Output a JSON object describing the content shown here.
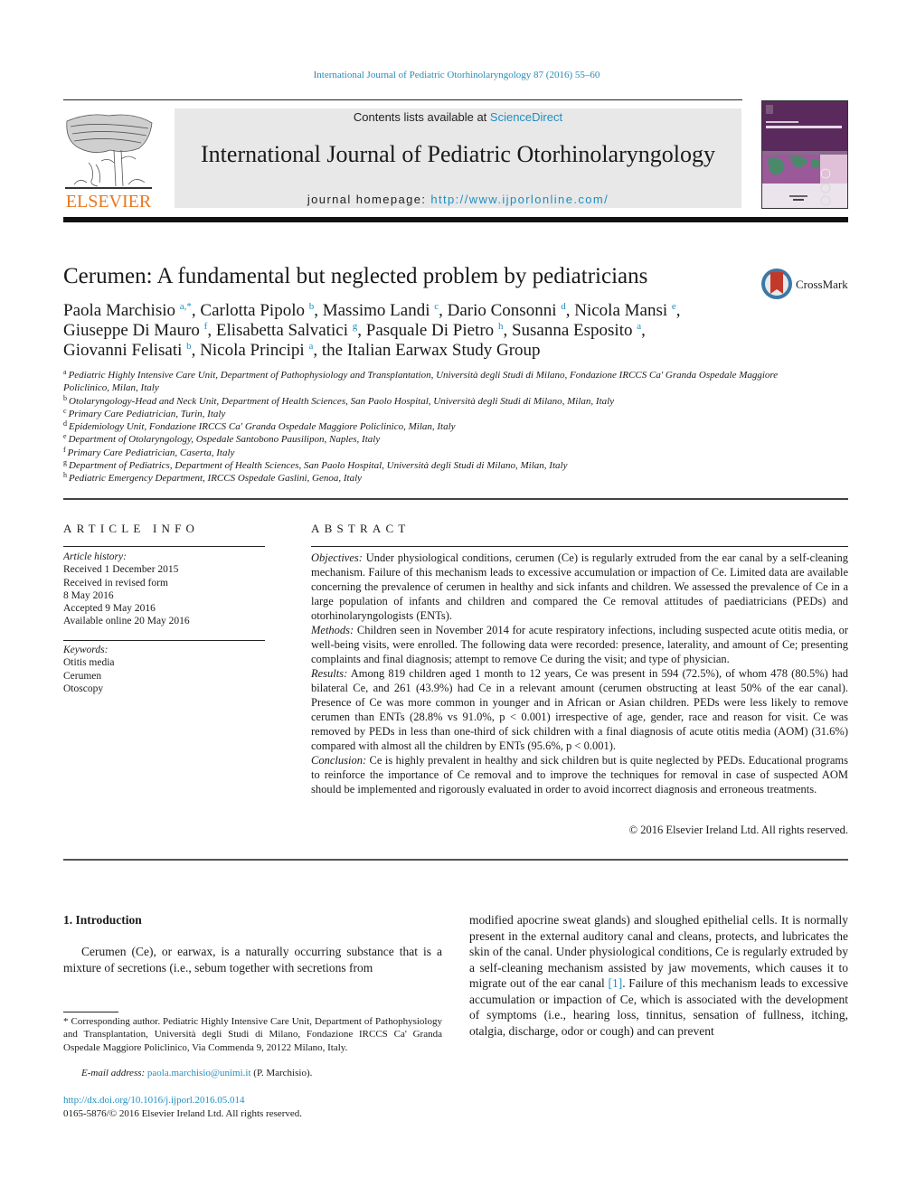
{
  "running_header": "International Journal of Pediatric Otorhinolaryngology 87 (2016) 55–60",
  "masthead": {
    "publisher_logo_text": "ELSEVIER",
    "contents_prefix": "Contents lists available at ",
    "contents_link": "ScienceDirect",
    "journal_title": "International Journal of Pediatric Otorhinolaryngology",
    "homepage_prefix": "journal homepage: ",
    "homepage_url": "http://www.ijporlonline.com/",
    "cover_title": "Pediatric Otorhinolaryngology"
  },
  "colors": {
    "link": "#1f8fc0",
    "elsevier_orange": "#e87722",
    "masthead_bg": "#e8e8e8",
    "cover_purple": "#5a2a5c"
  },
  "article": {
    "title": "Cerumen: A fundamental but neglected problem by pediatricians",
    "crossmark_label": "CrossMark",
    "authors": [
      {
        "name": "Paola Marchisio",
        "aff": "a,*",
        "sep": ", "
      },
      {
        "name": "Carlotta Pipolo",
        "aff": "b",
        "sep": ", "
      },
      {
        "name": "Massimo Landi",
        "aff": "c",
        "sep": ", "
      },
      {
        "name": "Dario Consonni",
        "aff": "d",
        "sep": ", "
      },
      {
        "name": "Nicola Mansi",
        "aff": "e",
        "sep": ","
      },
      {
        "name": "Giuseppe Di Mauro",
        "aff": "f",
        "sep": ", "
      },
      {
        "name": "Elisabetta Salvatici",
        "aff": "g",
        "sep": ", "
      },
      {
        "name": "Pasquale Di Pietro",
        "aff": "h",
        "sep": ", "
      },
      {
        "name": "Susanna Esposito",
        "aff": "a",
        "sep": ","
      },
      {
        "name": "Giovanni Felisati",
        "aff": "b",
        "sep": ", "
      },
      {
        "name": "Nicola Principi",
        "aff": "a",
        "sep": ", "
      },
      {
        "name": "the Italian Earwax Study Group",
        "aff": "",
        "sep": ""
      }
    ],
    "affiliations": [
      {
        "key": "a",
        "text": "Pediatric Highly Intensive Care Unit, Department of Pathophysiology and Transplantation, Università degli Studi di Milano, Fondazione IRCCS Ca' Granda Ospedale Maggiore Policlinico, Milan, Italy"
      },
      {
        "key": "b",
        "text": "Otolaryngology-Head and Neck Unit, Department of Health Sciences, San Paolo Hospital, Università degli Studi di Milano, Milan, Italy"
      },
      {
        "key": "c",
        "text": "Primary Care Pediatrician, Turin, Italy"
      },
      {
        "key": "d",
        "text": "Epidemiology Unit, Fondazione IRCCS Ca' Granda Ospedale Maggiore Policlinico, Milan, Italy"
      },
      {
        "key": "e",
        "text": "Department of Otolaryngology, Ospedale Santobono Pausilipon, Naples, Italy"
      },
      {
        "key": "f",
        "text": "Primary Care Pediatrician, Caserta, Italy"
      },
      {
        "key": "g",
        "text": "Department of Pediatrics, Department of Health Sciences, San Paolo Hospital, Università degli Studi di Milano, Milan, Italy"
      },
      {
        "key": "h",
        "text": "Pediatric Emergency Department, IRCCS Ospedale Gaslini, Genoa, Italy"
      }
    ]
  },
  "article_info": {
    "heading": "ARTICLE INFO",
    "history_label": "Article history:",
    "history": [
      "Received 1 December 2015",
      "Received in revised form",
      "8 May 2016",
      "Accepted 9 May 2016",
      "Available online 20 May 2016"
    ],
    "keywords_label": "Keywords:",
    "keywords": [
      "Otitis media",
      "Cerumen",
      "Otoscopy"
    ]
  },
  "abstract": {
    "heading": "ABSTRACT",
    "sections": [
      {
        "label": "Objectives:",
        "text": "Under physiological conditions, cerumen (Ce) is regularly extruded from the ear canal by a self-cleaning mechanism. Failure of this mechanism leads to excessive accumulation or impaction of Ce. Limited data are available concerning the prevalence of cerumen in healthy and sick infants and children. We assessed the prevalence of Ce in a large population of infants and children and compared the Ce removal attitudes of paediatricians (PEDs) and otorhinolaryngologists (ENTs)."
      },
      {
        "label": "Methods:",
        "text": "Children seen in November 2014 for acute respiratory infections, including suspected acute otitis media, or well-being visits, were enrolled. The following data were recorded: presence, laterality, and amount of Ce; presenting complaints and final diagnosis; attempt to remove Ce during the visit; and type of physician."
      },
      {
        "label": "Results:",
        "text": "Among 819 children aged 1 month to 12 years, Ce was present in 594 (72.5%), of whom 478 (80.5%) had bilateral Ce, and 261 (43.9%) had Ce in a relevant amount (cerumen obstructing at least 50% of the ear canal). Presence of Ce was more common in younger and in African or Asian children. PEDs were less likely to remove cerumen than ENTs (28.8% vs 91.0%, p < 0.001) irrespective of age, gender, race and reason for visit. Ce was removed by PEDs in less than one-third of sick children with a final diagnosis of acute otitis media (AOM) (31.6%) compared with almost all the children by ENTs (95.6%, p < 0.001)."
      },
      {
        "label": "Conclusion:",
        "text": "Ce is highly prevalent in healthy and sick children but is quite neglected by PEDs. Educational programs to reinforce the importance of Ce removal and to improve the techniques for removal in case of suspected AOM should be implemented and rigorously evaluated in order to avoid incorrect diagnosis and erroneous treatments."
      }
    ],
    "copyright": "© 2016 Elsevier Ireland Ltd. All rights reserved."
  },
  "body": {
    "intro_heading": "1.  Introduction",
    "intro_left": "Cerumen (Ce), or earwax, is a naturally occurring substance that is a mixture of secretions (i.e., sebum together with secretions from",
    "intro_right_before_ref": "modified apocrine sweat glands) and sloughed epithelial cells. It is normally present in the external auditory canal and cleans, protects, and lubricates the skin of the canal. Under physiological conditions, Ce is regularly extruded by a self-cleaning mechanism assisted by jaw movements, which causes it to migrate out of the ear canal ",
    "intro_right_ref": "[1]",
    "intro_right_after_ref": ". Failure of this mechanism leads to excessive accumulation or impaction of Ce, which is associated with the development of symptoms (i.e., hearing loss, tinnitus, sensation of fullness, itching, otalgia, discharge, odor or cough) and can prevent"
  },
  "footnotes": {
    "corresponding": "* Corresponding author. Pediatric Highly Intensive Care Unit, Department of Pathophysiology and Transplantation, Università degli Studi di Milano, Fondazione IRCCS Ca' Granda Ospedale Maggiore Policlinico, Via Commenda 9, 20122 Milano, Italy.",
    "email_label": "E-mail address: ",
    "email": "paola.marchisio@unimi.it",
    "email_suffix": " (P. Marchisio).",
    "doi": "http://dx.doi.org/10.1016/j.ijporl.2016.05.014",
    "issn_copyright": "0165-5876/© 2016 Elsevier Ireland Ltd. All rights reserved."
  }
}
